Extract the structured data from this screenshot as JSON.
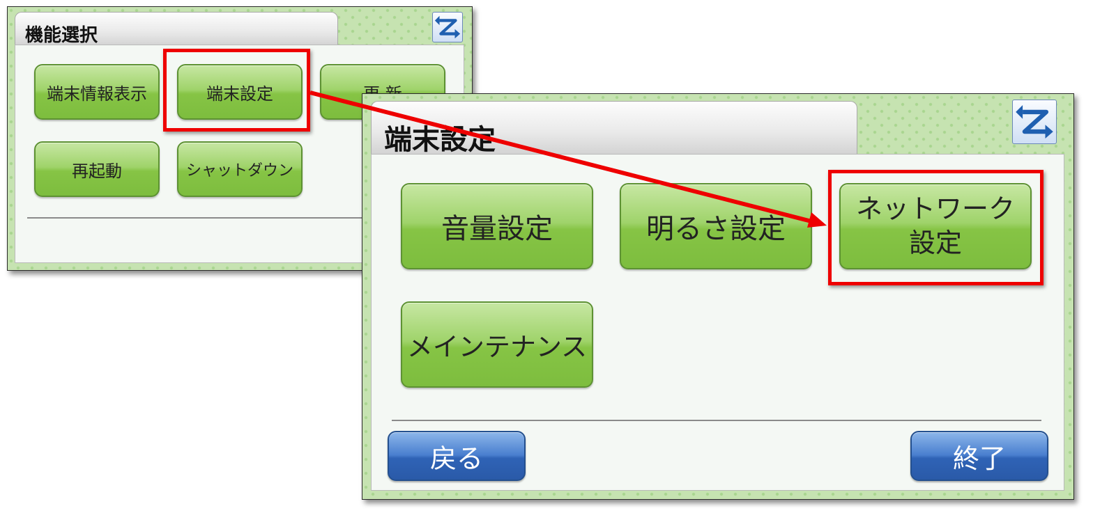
{
  "function_select": {
    "title": "機能選択",
    "buttons": [
      "端末情報表示",
      "端末設定",
      "更 新",
      "再起動",
      "シャットダウン"
    ]
  },
  "device_settings": {
    "title": "端末設定",
    "buttons": [
      "音量設定",
      "明るさ設定",
      "ネットワーク\n設定",
      "メインテナンス"
    ],
    "back_label": "戻る",
    "exit_label": "終了"
  },
  "icons": {
    "back": "return-arrow-icon"
  },
  "colors": {
    "button_green": "#8cc84f",
    "button_blue": "#3a6fc2",
    "highlight_red": "#ee0000",
    "pattern_bg": "#c6e3b1"
  }
}
